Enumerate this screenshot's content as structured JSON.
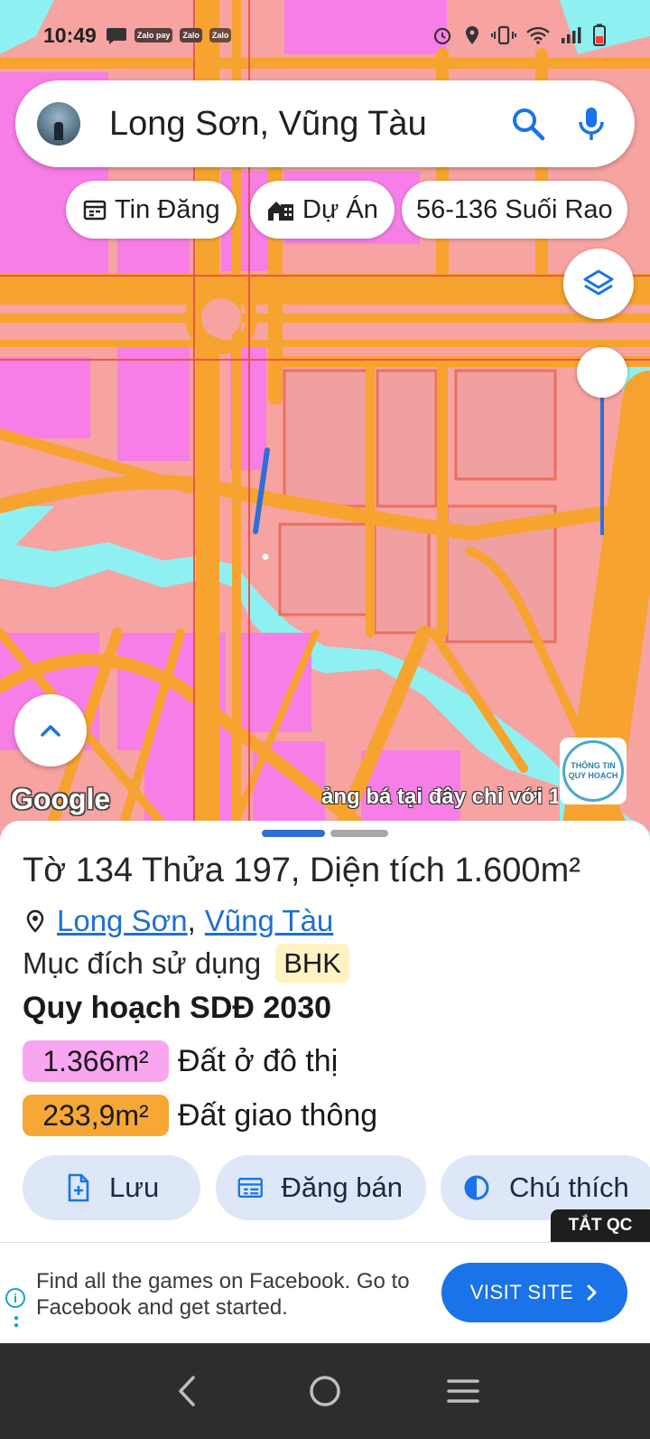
{
  "status_bar": {
    "time": "10:49",
    "notifications": [
      "Zalo pay",
      "Zalo",
      "Zalo"
    ]
  },
  "search": {
    "query": "Long Sơn, Vũng Tàu"
  },
  "chips": [
    {
      "label": "Tin Đăng",
      "icon": "calendar-icon"
    },
    {
      "label": "Dự Án",
      "icon": "building-icon"
    },
    {
      "label": "56-136 Suối Rao",
      "icon": ""
    }
  ],
  "map": {
    "attribution": "Google",
    "marquee": "ảng bá tại đây chỉ với 1",
    "partner_logo": {
      "line1": "THÔNG TIN",
      "line2": "QUY HOẠCH"
    },
    "colors": {
      "residential": "#f6a3a1",
      "urban": "#f77ee6",
      "road": "#f7a32f",
      "water": "#8ff0f2",
      "selection": "#2f6fd6"
    }
  },
  "parcel": {
    "title": "Tờ 134 Thửa 197, Diện tích 1.600m²",
    "location_link_1": "Long Sơn",
    "location_separator": ",",
    "location_link_2": "Vũng Tàu",
    "purpose_label": "Mục đích sử dụng",
    "purpose_code": "BHK",
    "plan_title": "Quy hoạch SDĐ 2030",
    "land_uses": [
      {
        "area": "1.366m²",
        "label": "Đất ở đô thị",
        "color": "#f9a6f1"
      },
      {
        "area": "233,9m²",
        "label": "Đất giao thông",
        "color": "#f7a735"
      }
    ]
  },
  "actions": [
    {
      "label": "Lưu",
      "icon": "save-file-icon"
    },
    {
      "label": "Đăng bán",
      "icon": "listing-icon"
    },
    {
      "label": "Chú thích",
      "icon": "legend-icon"
    }
  ],
  "ad": {
    "close_label": "TẮT QC",
    "info_glyph": "i",
    "text": "Find all the games on Facebook. Go to Facebook and get started.",
    "cta": "VISIT SITE"
  },
  "nav": {
    "back": "back-icon",
    "home": "home-icon",
    "recents": "recents-icon"
  }
}
